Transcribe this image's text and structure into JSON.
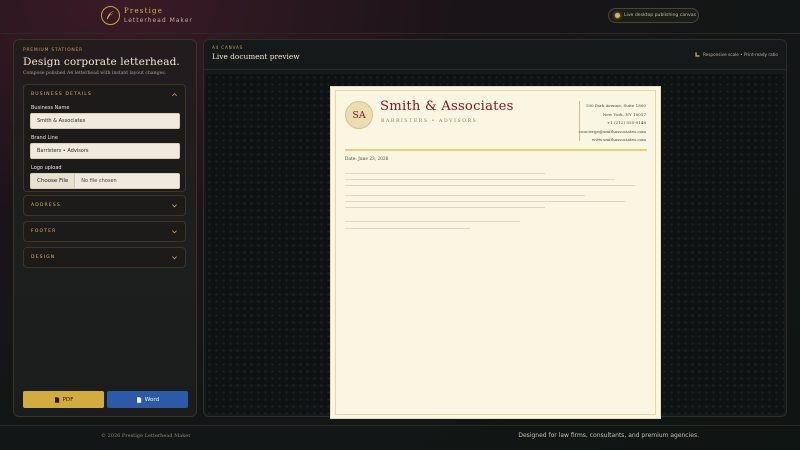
{
  "header": {
    "brand_name": "Prestige",
    "brand_sub": "Letterhead Maker",
    "pill_text": "Live desktop publishing canvas"
  },
  "sidebar": {
    "eyebrow": "Premium Stationer",
    "title": "Design corporate letterhead.",
    "description": "Compose polished A4 letterhead with instant layout changes.",
    "sections": {
      "business": {
        "label": "Business details",
        "expanded": true,
        "fields": {
          "business_name_label": "Business Name",
          "business_name_value": "Smith & Associates",
          "brand_line_label": "Brand Line",
          "brand_line_value": "Barristers • Advisors",
          "logo_label": "Logo upload",
          "file_button": "Choose File",
          "file_status": "No file chosen"
        }
      },
      "address": {
        "label": "Address",
        "expanded": false
      },
      "footer": {
        "label": "Footer",
        "expanded": false
      },
      "design": {
        "label": "Design",
        "expanded": false
      }
    },
    "buttons": {
      "pdf": "PDF",
      "word": "Word"
    }
  },
  "main": {
    "eyebrow": "A4 Canvas",
    "title": "Live document preview",
    "meta": "Responsive scale • Print-ready ratio"
  },
  "letterhead": {
    "monogram": "SA",
    "company": "Smith & Associates",
    "tagline": "Barristers • Advisors",
    "address_lines": [
      "100 Park Avenue, Suite 1800",
      "New York, NY 10017",
      "+1 (212) 555-0148",
      "concierge@smithassociates.com",
      "www.smithassociates.com"
    ],
    "date": "Date: June 23, 2026"
  },
  "footer": {
    "copyright": "© 2026 Prestige Letterhead Maker",
    "tagline": "Designed for law firms, consultants, and premium agencies."
  },
  "colors": {
    "gold": "#d9b45a",
    "burgundy": "#8a1328",
    "word_blue": "#2c5aa6",
    "paper": "#fbf6e2"
  }
}
